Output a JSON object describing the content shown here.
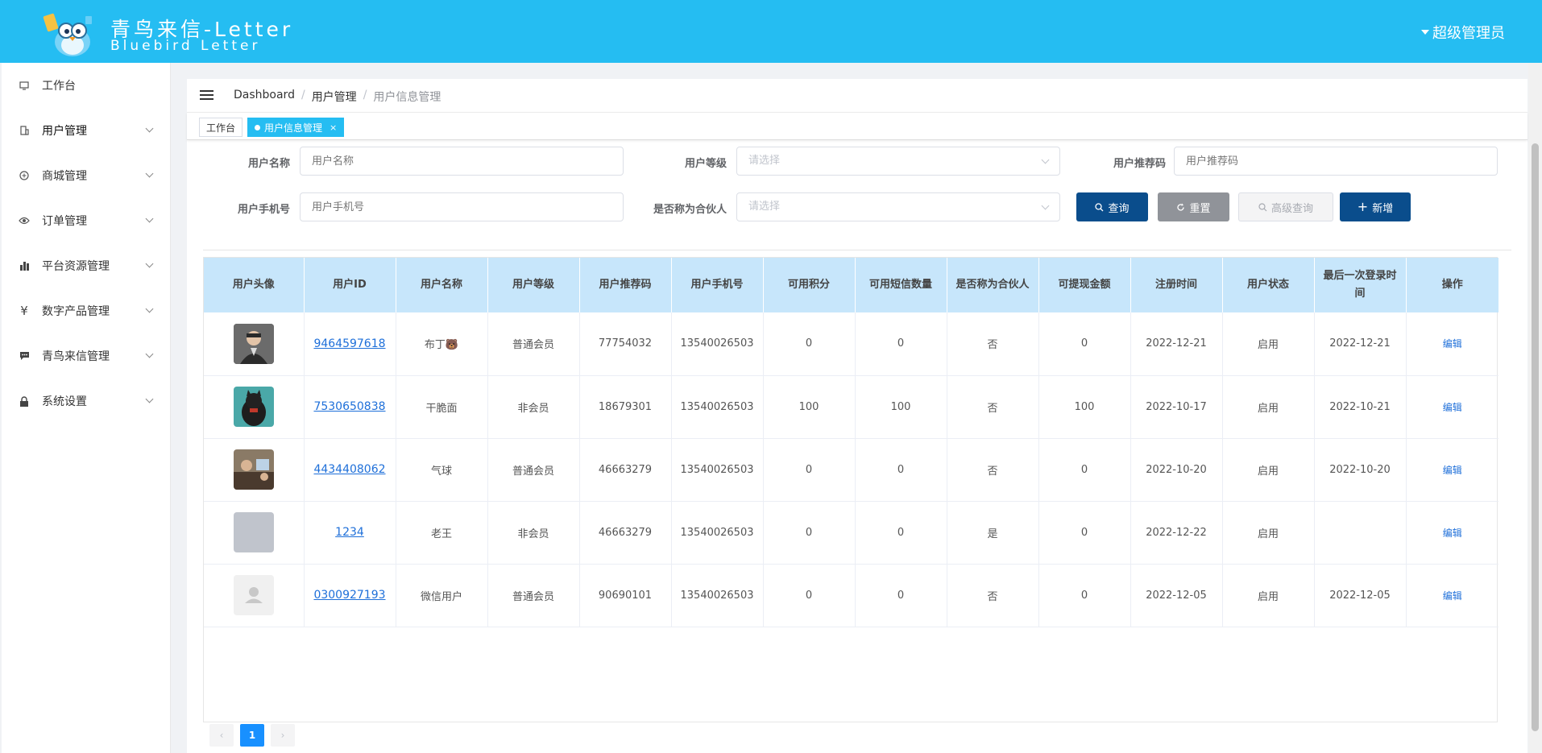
{
  "header": {
    "title": "青鸟来信-Letter",
    "subtitle": "Bluebird Letter",
    "user": "超级管理员",
    "brand_color": "#25bdf2"
  },
  "sidebar": {
    "items": [
      {
        "label": "工作台",
        "icon": "monitor-icon"
      },
      {
        "label": "用户管理",
        "icon": "building-icon"
      },
      {
        "label": "商城管理",
        "icon": "plus-circle-icon"
      },
      {
        "label": "订单管理",
        "icon": "eye-icon"
      },
      {
        "label": "平台资源管理",
        "icon": "bar-chart-icon"
      },
      {
        "label": "数字产品管理",
        "icon": "yen-icon"
      },
      {
        "label": "青鸟来信管理",
        "icon": "message-icon"
      },
      {
        "label": "系统设置",
        "icon": "lock-icon"
      }
    ]
  },
  "breadcrumb": {
    "items": [
      "Dashboard",
      "用户管理",
      "用户信息管理"
    ]
  },
  "tabs": [
    {
      "label": "工作台"
    },
    {
      "label": "用户信息管理",
      "close": "×"
    }
  ],
  "filters": {
    "name_label": "用户名称",
    "name_placeholder": "用户名称",
    "level_label": "用户等级",
    "level_placeholder": "请选择",
    "code_label": "用户推荐码",
    "code_placeholder": "用户推荐码",
    "phone_label": "用户手机号",
    "phone_placeholder": "用户手机号",
    "partner_label": "是否称为合伙人",
    "partner_placeholder": "请选择"
  },
  "buttons": {
    "query": "查询",
    "reset": "重置",
    "advanced": "高级查询",
    "add": "新增"
  },
  "table": {
    "columns": [
      "用户头像",
      "用户ID",
      "用户名称",
      "用户等级",
      "用户推荐码",
      "用户手机号",
      "可用积分",
      "可用短信数量",
      "是否称为合伙人",
      "可提现金额",
      "注册时间",
      "用户状态",
      "最后一次登录时间",
      "操作"
    ],
    "rows": [
      {
        "id": "9464597618",
        "name": "布丁🐻",
        "level": "普通会员",
        "code": "77754032",
        "phone": "13540026503",
        "points": "0",
        "sms": "0",
        "partner": "否",
        "cash": "0",
        "reg": "2022-12-21",
        "status": "启用",
        "last": "2022-12-21",
        "action": "编辑"
      },
      {
        "id": "7530650838",
        "name": "干脆面",
        "level": "非会员",
        "code": "18679301",
        "phone": "13540026503",
        "points": "100",
        "sms": "100",
        "partner": "否",
        "cash": "100",
        "reg": "2022-10-17",
        "status": "启用",
        "last": "2022-10-21",
        "action": "编辑"
      },
      {
        "id": "4434408062",
        "name": "气球",
        "level": "普通会员",
        "code": "46663279",
        "phone": "13540026503",
        "points": "0",
        "sms": "0",
        "partner": "否",
        "cash": "0",
        "reg": "2022-10-20",
        "status": "启用",
        "last": "2022-10-20",
        "action": "编辑"
      },
      {
        "id": "1234",
        "name": "老王",
        "level": "非会员",
        "code": "46663279",
        "phone": "13540026503",
        "points": "0",
        "sms": "0",
        "partner": "是",
        "cash": "0",
        "reg": "2022-12-22",
        "status": "启用",
        "last": "",
        "action": "编辑"
      },
      {
        "id": "0300927193",
        "name": "微信用户",
        "level": "普通会员",
        "code": "90690101",
        "phone": "13540026503",
        "points": "0",
        "sms": "0",
        "partner": "否",
        "cash": "0",
        "reg": "2022-12-05",
        "status": "启用",
        "last": "2022-12-05",
        "action": "编辑"
      }
    ]
  },
  "pagination": {
    "prev": "‹",
    "current": "1",
    "next": "›"
  }
}
